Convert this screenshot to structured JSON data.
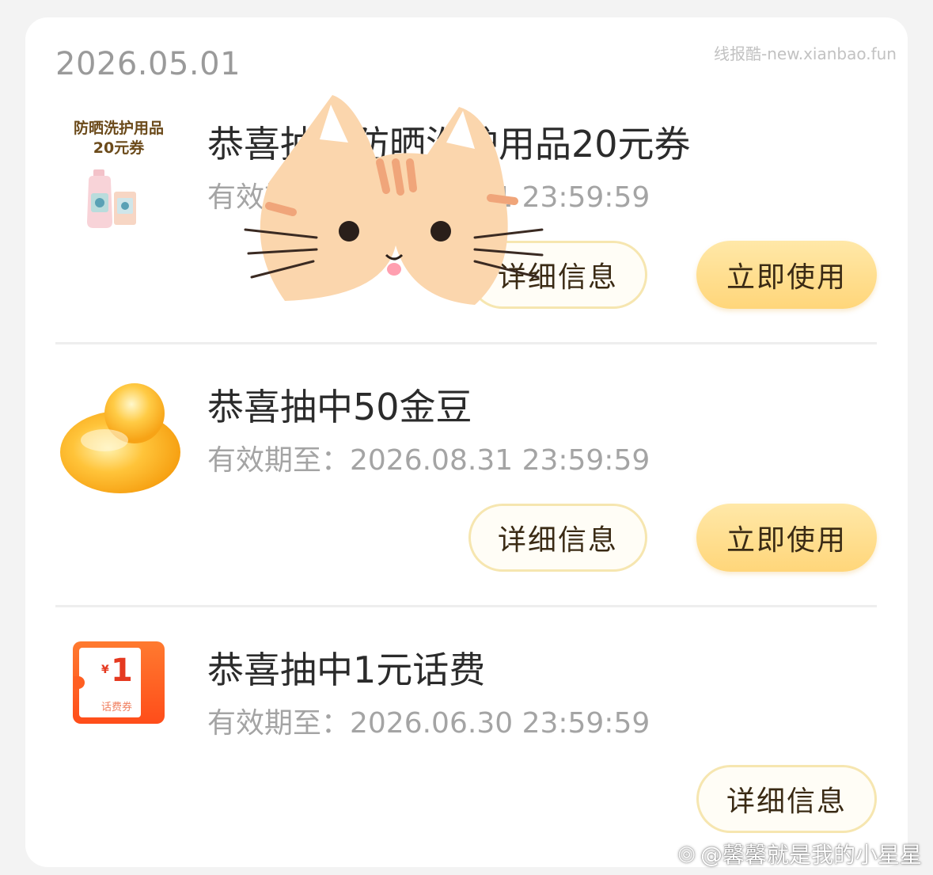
{
  "header": {
    "date": "2026.05.01",
    "watermark": "线报酷-new.xianbao.fun"
  },
  "prizes": [
    {
      "title": "恭喜抽中防晒洗护用品20元券",
      "validity": "有效期至：2026.08.31 23:59:59",
      "icon_label_line1": "防晒洗护用品",
      "icon_label_line2": "20元券",
      "detail_label": "详细信息",
      "use_label": "立即使用"
    },
    {
      "title": "恭喜抽中50金豆",
      "validity": "有效期至：2026.08.31 23:59:59",
      "detail_label": "详细信息",
      "use_label": "立即使用"
    },
    {
      "title": "恭喜抽中1元话费",
      "validity": "有效期至：2026.06.30 23:59:59",
      "icon_amount": "1",
      "icon_currency": "¥",
      "icon_caption": "话费券",
      "detail_label": "详细信息"
    }
  ],
  "footer": {
    "watermark": "@馨馨就是我的小星星"
  },
  "colors": {
    "accent": "#ffd67a",
    "button_border": "#f6e6b0"
  },
  "icons": {
    "product": "sunscreen-product-icon",
    "bean": "gold-bean-icon",
    "ticket": "phone-credit-ticket-icon",
    "overlay": "cat-face-sticker"
  }
}
